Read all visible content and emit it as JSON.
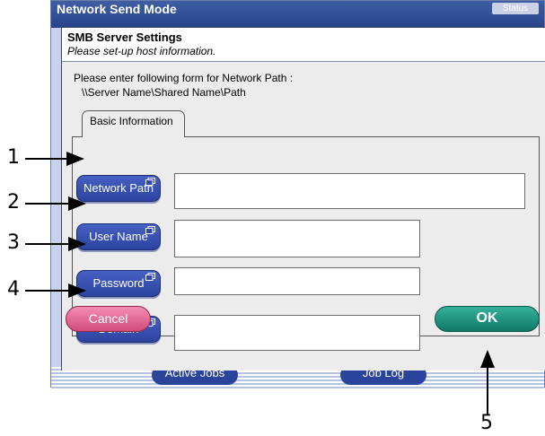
{
  "window": {
    "title": "Network Send Mode",
    "status_label": "Status"
  },
  "background_tabs": [
    {
      "label": "Active Jobs"
    },
    {
      "label": "Job Log"
    }
  ],
  "dialog": {
    "title": "SMB Server Settings",
    "subtitle": "Please set-up host information.",
    "instruction_line1": "Please enter following form for Network Path :",
    "instruction_line2": "\\\\Server Name\\Shared Name\\Path",
    "tab_label": "Basic Information",
    "fields": [
      {
        "label": "Network Path",
        "value": ""
      },
      {
        "label": "User Name",
        "value": ""
      },
      {
        "label": "Password",
        "value": ""
      },
      {
        "label": "Domain",
        "value": ""
      }
    ],
    "cancel_label": "Cancel",
    "ok_label": "OK"
  },
  "callouts": [
    "1",
    "2",
    "3",
    "4",
    "5"
  ],
  "colors": {
    "field_button": "#2f49a6",
    "cancel": "#e36592",
    "ok": "#1f9482",
    "title_bar": "#2f4d93"
  }
}
